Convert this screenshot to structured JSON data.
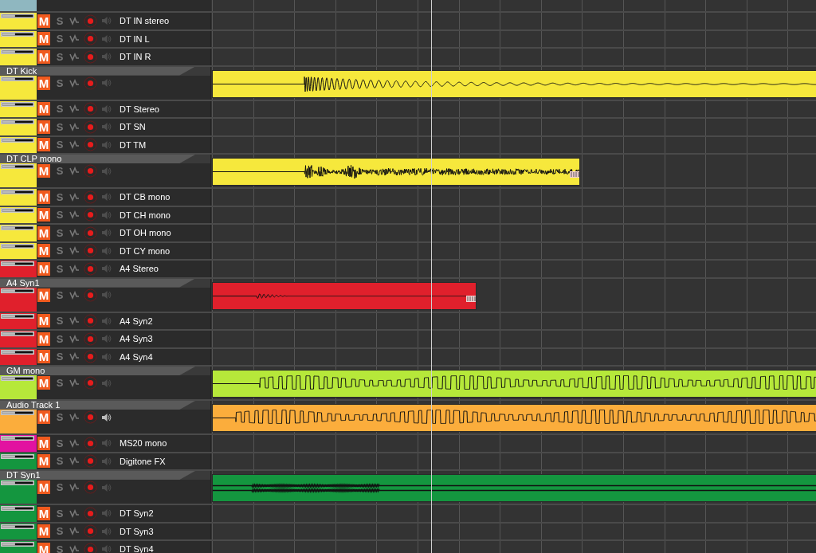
{
  "tracks": [
    {
      "kind": "stub",
      "color": "#8fb7c0"
    },
    {
      "kind": "compact",
      "name": "DT IN stereo",
      "color": "#f6e83c",
      "fader": {
        "level": 0.42
      },
      "mute": {
        "label": "M",
        "on": true
      },
      "solo": {
        "label": "S",
        "on": false
      },
      "monitor_on": false
    },
    {
      "kind": "compact",
      "name": "DT IN L",
      "color": "#f6e83c",
      "fader": {
        "level": 0.42
      },
      "mute": {
        "label": "M",
        "on": true
      },
      "solo": {
        "label": "S",
        "on": false
      },
      "monitor_on": false
    },
    {
      "kind": "compact",
      "name": "DT IN R",
      "color": "#f6e83c",
      "fader": {
        "level": 0.42
      },
      "mute": {
        "label": "M",
        "on": true
      },
      "solo": {
        "label": "S",
        "on": false
      },
      "monitor_on": false
    },
    {
      "kind": "expanded",
      "name": "DT Kick",
      "color": "#f6e83c",
      "fader": {
        "level": 0.42
      },
      "mute": {
        "label": "M",
        "on": true
      },
      "solo": {
        "label": "S",
        "on": false
      },
      "monitor_on": false,
      "region": {
        "trim_handle": false
      }
    },
    {
      "kind": "compact",
      "name": "DT Stereo",
      "color": "#f6e83c",
      "fader": {
        "level": 0.42
      },
      "mute": {
        "label": "M",
        "on": true
      },
      "solo": {
        "label": "S",
        "on": false
      },
      "monitor_on": false
    },
    {
      "kind": "compact",
      "name": "DT SN",
      "color": "#f6e83c",
      "fader": {
        "level": 0.42
      },
      "mute": {
        "label": "M",
        "on": true
      },
      "solo": {
        "label": "S",
        "on": false
      },
      "monitor_on": false
    },
    {
      "kind": "compact",
      "name": "DT TM",
      "color": "#f6e83c",
      "fader": {
        "level": 0.42
      },
      "mute": {
        "label": "M",
        "on": true
      },
      "solo": {
        "label": "S",
        "on": false
      },
      "monitor_on": false
    },
    {
      "kind": "expanded",
      "name": "DT CLP mono",
      "color": "#f6e83c",
      "fader": {
        "level": 0.42
      },
      "mute": {
        "label": "M",
        "on": true
      },
      "solo": {
        "label": "S",
        "on": false
      },
      "monitor_on": false,
      "region": {
        "trim_handle": true
      }
    },
    {
      "kind": "compact",
      "name": "DT CB mono",
      "color": "#f6e83c",
      "fader": {
        "level": 0.42
      },
      "mute": {
        "label": "M",
        "on": true
      },
      "solo": {
        "label": "S",
        "on": false
      },
      "monitor_on": false
    },
    {
      "kind": "compact",
      "name": "DT CH mono",
      "color": "#f6e83c",
      "fader": {
        "level": 0.42
      },
      "mute": {
        "label": "M",
        "on": true
      },
      "solo": {
        "label": "S",
        "on": false
      },
      "monitor_on": false
    },
    {
      "kind": "compact",
      "name": "DT OH mono",
      "color": "#f6e83c",
      "fader": {
        "level": 0.42
      },
      "mute": {
        "label": "M",
        "on": true
      },
      "solo": {
        "label": "S",
        "on": false
      },
      "monitor_on": false
    },
    {
      "kind": "compact",
      "name": "DT CY mono",
      "color": "#f6e83c",
      "fader": {
        "level": 0.42
      },
      "mute": {
        "label": "M",
        "on": true
      },
      "solo": {
        "label": "S",
        "on": false
      },
      "monitor_on": false
    },
    {
      "kind": "compact",
      "name": "A4 Stereo",
      "color": "#e0202c",
      "fader": {
        "level": 0.42
      },
      "mute": {
        "label": "M",
        "on": true
      },
      "solo": {
        "label": "S",
        "on": false
      },
      "monitor_on": false
    },
    {
      "kind": "expanded",
      "name": "A4 Syn1",
      "color": "#e0202c",
      "fader": {
        "level": 0.42
      },
      "mute": {
        "label": "M",
        "on": true
      },
      "solo": {
        "label": "S",
        "on": false
      },
      "monitor_on": false,
      "region": {
        "trim_handle": true
      }
    },
    {
      "kind": "compact",
      "name": "A4 Syn2",
      "color": "#e0202c",
      "fader": {
        "level": 0.42
      },
      "mute": {
        "label": "M",
        "on": true
      },
      "solo": {
        "label": "S",
        "on": false
      },
      "monitor_on": false
    },
    {
      "kind": "compact",
      "name": "A4 Syn3",
      "color": "#e0202c",
      "fader": {
        "level": 0.42
      },
      "mute": {
        "label": "M",
        "on": true
      },
      "solo": {
        "label": "S",
        "on": false
      },
      "monitor_on": false
    },
    {
      "kind": "compact",
      "name": "A4 Syn4",
      "color": "#e0202c",
      "fader": {
        "level": 0.42
      },
      "mute": {
        "label": "M",
        "on": true
      },
      "solo": {
        "label": "S",
        "on": false
      },
      "monitor_on": false
    },
    {
      "kind": "expanded",
      "name": "GM mono",
      "color": "#b6e83a",
      "fader": {
        "level": 0.42
      },
      "mute": {
        "label": "M",
        "on": true
      },
      "solo": {
        "label": "S",
        "on": false
      },
      "monitor_on": false,
      "region": {
        "trim_handle": false
      }
    },
    {
      "kind": "expanded",
      "name": "Audio Track 1",
      "color": "#fbad3c",
      "fader": {
        "level": 0.42
      },
      "mute": {
        "label": "M",
        "on": true
      },
      "solo": {
        "label": "S",
        "on": false
      },
      "monitor_on": true,
      "region": {
        "trim_handle": false
      }
    },
    {
      "kind": "compact",
      "name": "MS20 mono",
      "color": "#e212a0",
      "fader": {
        "level": 0.42
      },
      "mute": {
        "label": "M",
        "on": true
      },
      "solo": {
        "label": "S",
        "on": false
      },
      "monitor_on": false
    },
    {
      "kind": "compact",
      "name": "Digitone FX",
      "color": "#14963f",
      "fader": {
        "level": 0.42
      },
      "mute": {
        "label": "M",
        "on": true
      },
      "solo": {
        "label": "S",
        "on": false
      },
      "monitor_on": false
    },
    {
      "kind": "expanded",
      "name": "DT Syn1",
      "color": "#14963f",
      "fader": {
        "level": 0.42
      },
      "mute": {
        "label": "M",
        "on": true
      },
      "solo": {
        "label": "S",
        "on": false
      },
      "monitor_on": false,
      "region": {
        "trim_handle": false
      }
    },
    {
      "kind": "compact",
      "name": "DT Syn2",
      "color": "#14963f",
      "fader": {
        "level": 0.42
      },
      "mute": {
        "label": "M",
        "on": true
      },
      "solo": {
        "label": "S",
        "on": false
      },
      "monitor_on": false
    },
    {
      "kind": "compact",
      "name": "DT Syn3",
      "color": "#14963f",
      "fader": {
        "level": 0.42
      },
      "mute": {
        "label": "M",
        "on": true
      },
      "solo": {
        "label": "S",
        "on": false
      },
      "monitor_on": false
    },
    {
      "kind": "compact",
      "name": "DT Syn4",
      "color": "#14963f",
      "fader": {
        "level": 0.42
      },
      "mute": {
        "label": "M",
        "on": true
      },
      "solo": {
        "label": "S",
        "on": false
      },
      "monitor_on": false
    }
  ]
}
